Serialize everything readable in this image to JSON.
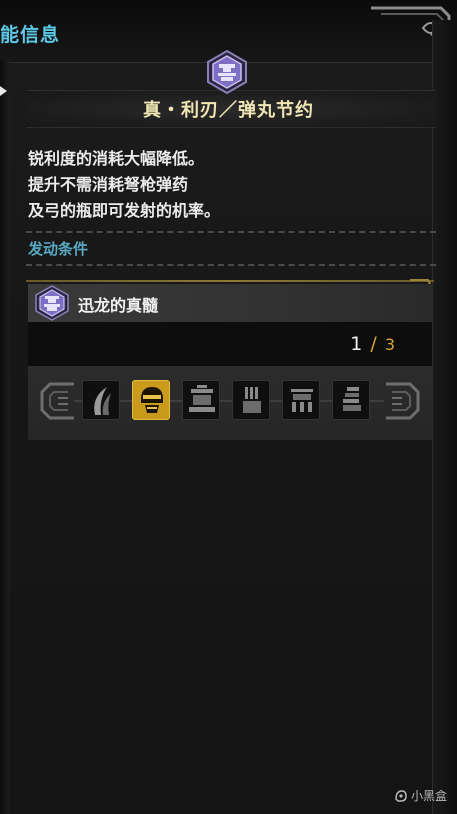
{
  "header": {
    "title": "能信息"
  },
  "skill": {
    "icon": "skill-gem-icon",
    "title": "真・利刃／弹丸节约",
    "description": [
      "锐利度的消耗大幅降低。",
      "提升不需消耗弩枪弹药",
      "及弓的瓶即可发射的机率。"
    ]
  },
  "condition": {
    "label": "发动条件",
    "name": "迅龙的真髓",
    "icon": "skill-gem-icon",
    "current": "1",
    "separator": "/",
    "total": "3",
    "slots": [
      {
        "icon": "claw-icon",
        "active": false
      },
      {
        "icon": "helmet-icon",
        "active": true
      },
      {
        "icon": "chest-armor-icon",
        "active": false
      },
      {
        "icon": "gauntlet-icon",
        "active": false
      },
      {
        "icon": "waist-armor-icon",
        "active": false
      },
      {
        "icon": "leg-armor-icon",
        "active": false
      }
    ]
  },
  "watermark": {
    "text": "小黑盒"
  },
  "colors": {
    "accent_cyan": "#5cc8e6",
    "gold": "#d7a435",
    "title_cream": "#f0e6b4"
  }
}
